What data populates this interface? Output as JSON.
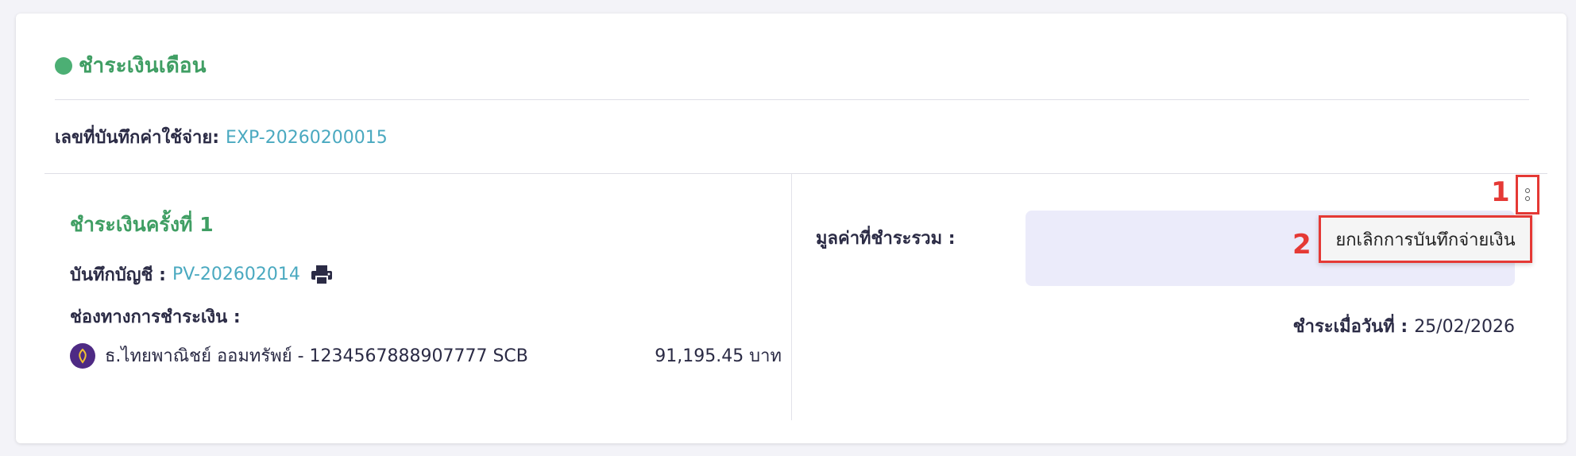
{
  "section": {
    "title": "ชำระเงินเดือน",
    "status_color": "#4caf74"
  },
  "expense": {
    "label": "เลขที่บันทึกค่าใช้จ่าย:",
    "number": "EXP-20260200015"
  },
  "payment": {
    "title": "ชำระเงินครั้งที่ 1",
    "voucher_label": "บันทึกบัญชี :",
    "voucher_number": "PV-202602014",
    "print_icon": "printer-icon",
    "channel_label": "ช่องทางการชำระเงิน :",
    "bank": {
      "icon": "scb-bank-logo",
      "name": "ธ.ไทยพาณิชย์ ออมทรัพย์ - 1234567888907777 SCB",
      "amount": "91,195.45 บาท"
    }
  },
  "summary": {
    "total_label": "มูลค่าที่ชำระรวม :",
    "paid_date_label": "ชำระเมื่อวันที่ :",
    "paid_date": "25/02/2026"
  },
  "actions": {
    "more_icon": "kebab-menu-icon",
    "menu_items": [
      "ยกเลิกการบันทึกจ่ายเงิน"
    ]
  },
  "annotations": {
    "step1": "1",
    "step2": "2"
  },
  "colors": {
    "accent_green": "#3f9e63",
    "link_teal": "#4aa9c0",
    "highlight_red": "#e53935",
    "total_box_bg": "#ebebfa"
  }
}
